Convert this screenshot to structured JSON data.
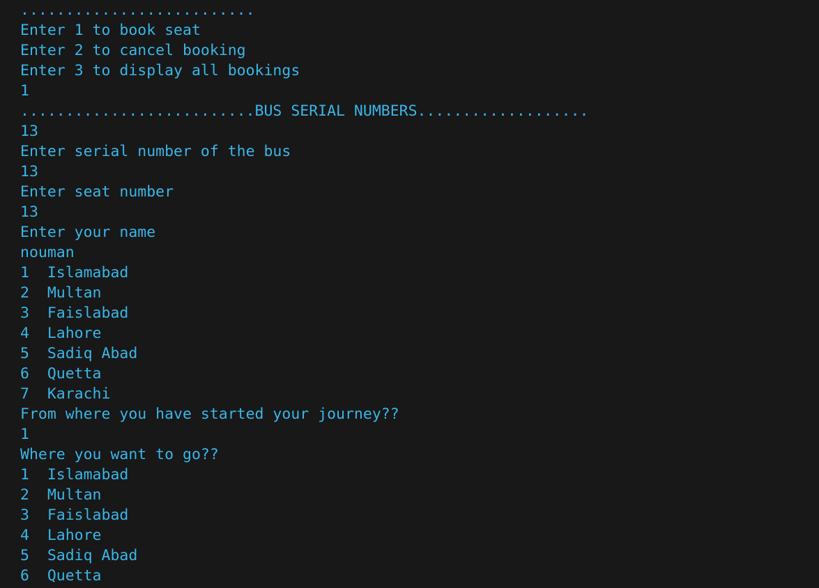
{
  "terminal": {
    "text_color": "#38b6e8",
    "background_color": "#181818",
    "lines": [
      "..........................",
      "Enter 1 to book seat",
      "Enter 2 to cancel booking",
      "Enter 3 to display all bookings",
      "1",
      "..........................BUS SERIAL NUMBERS...................",
      "13",
      "Enter serial number of the bus",
      "13",
      "Enter seat number",
      "13",
      "Enter your name",
      "nouman",
      "1  Islamabad",
      "2  Multan",
      "3  Faislabad",
      "4  Lahore",
      "5  Sadiq Abad",
      "6  Quetta",
      "7  Karachi",
      "From where you have started your journey??",
      "1",
      "Where you want to go??",
      "1  Islamabad",
      "2  Multan",
      "3  Faislabad",
      "4  Lahore",
      "5  Sadiq Abad",
      "6  Quetta"
    ]
  }
}
